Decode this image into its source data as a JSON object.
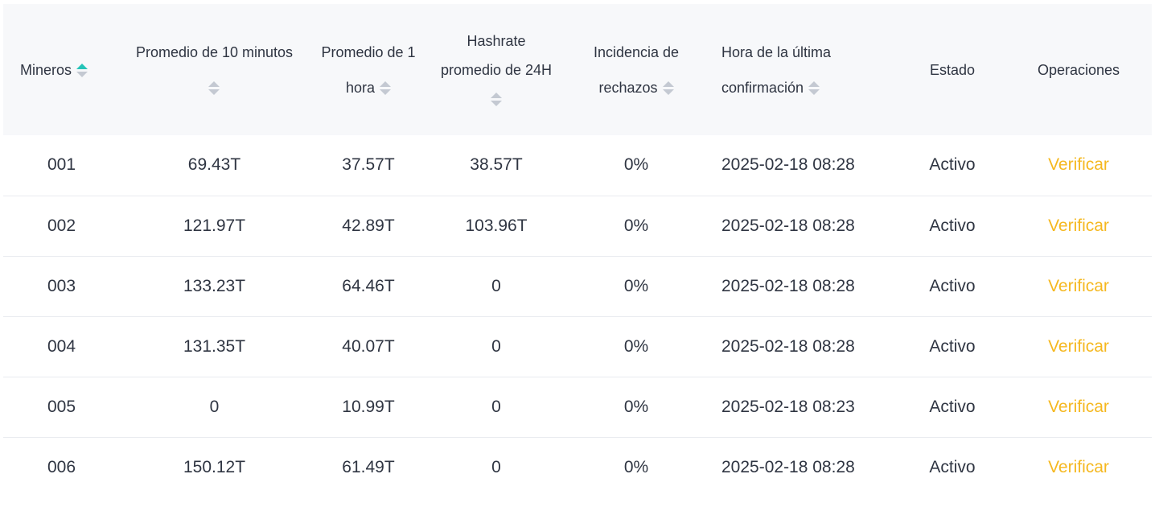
{
  "table": {
    "headers": {
      "miners": "Mineros",
      "avg10": "Promedio de 10 minutos",
      "avg1h_line1": "Promedio de 1",
      "avg1h_line2": "hora",
      "hash24_line1": "Hashrate",
      "hash24_line2": "promedio de 24H",
      "reject_line1": "Incidencia de",
      "reject_line2": "rechazos",
      "last_line1": "Hora de la última",
      "last_line2": "confirmación",
      "status": "Estado",
      "ops": "Operaciones"
    },
    "rows": [
      {
        "miner": "001",
        "avg10": "69.43T",
        "avg1h": "37.57T",
        "hash24": "38.57T",
        "reject": "0%",
        "last": "2025-02-18 08:28",
        "status": "Activo",
        "action": "Verificar"
      },
      {
        "miner": "002",
        "avg10": "121.97T",
        "avg1h": "42.89T",
        "hash24": "103.96T",
        "reject": "0%",
        "last": "2025-02-18 08:28",
        "status": "Activo",
        "action": "Verificar"
      },
      {
        "miner": "003",
        "avg10": "133.23T",
        "avg1h": "64.46T",
        "hash24": "0",
        "reject": "0%",
        "last": "2025-02-18 08:28",
        "status": "Activo",
        "action": "Verificar"
      },
      {
        "miner": "004",
        "avg10": "131.35T",
        "avg1h": "40.07T",
        "hash24": "0",
        "reject": "0%",
        "last": "2025-02-18 08:28",
        "status": "Activo",
        "action": "Verificar"
      },
      {
        "miner": "005",
        "avg10": "0",
        "avg1h": "10.99T",
        "hash24": "0",
        "reject": "0%",
        "last": "2025-02-18 08:23",
        "status": "Activo",
        "action": "Verificar"
      },
      {
        "miner": "006",
        "avg10": "150.12T",
        "avg1h": "61.49T",
        "hash24": "0",
        "reject": "0%",
        "last": "2025-02-18 08:28",
        "status": "Activo",
        "action": "Verificar"
      }
    ]
  },
  "colors": {
    "accent": "#25c4b8",
    "action": "#f5b820",
    "header_bg": "#f7f8fa",
    "text": "#2f3542"
  },
  "icons": {
    "sort": "sort-arrows-icon"
  },
  "sort": {
    "column": "miners",
    "direction": "ascending"
  }
}
